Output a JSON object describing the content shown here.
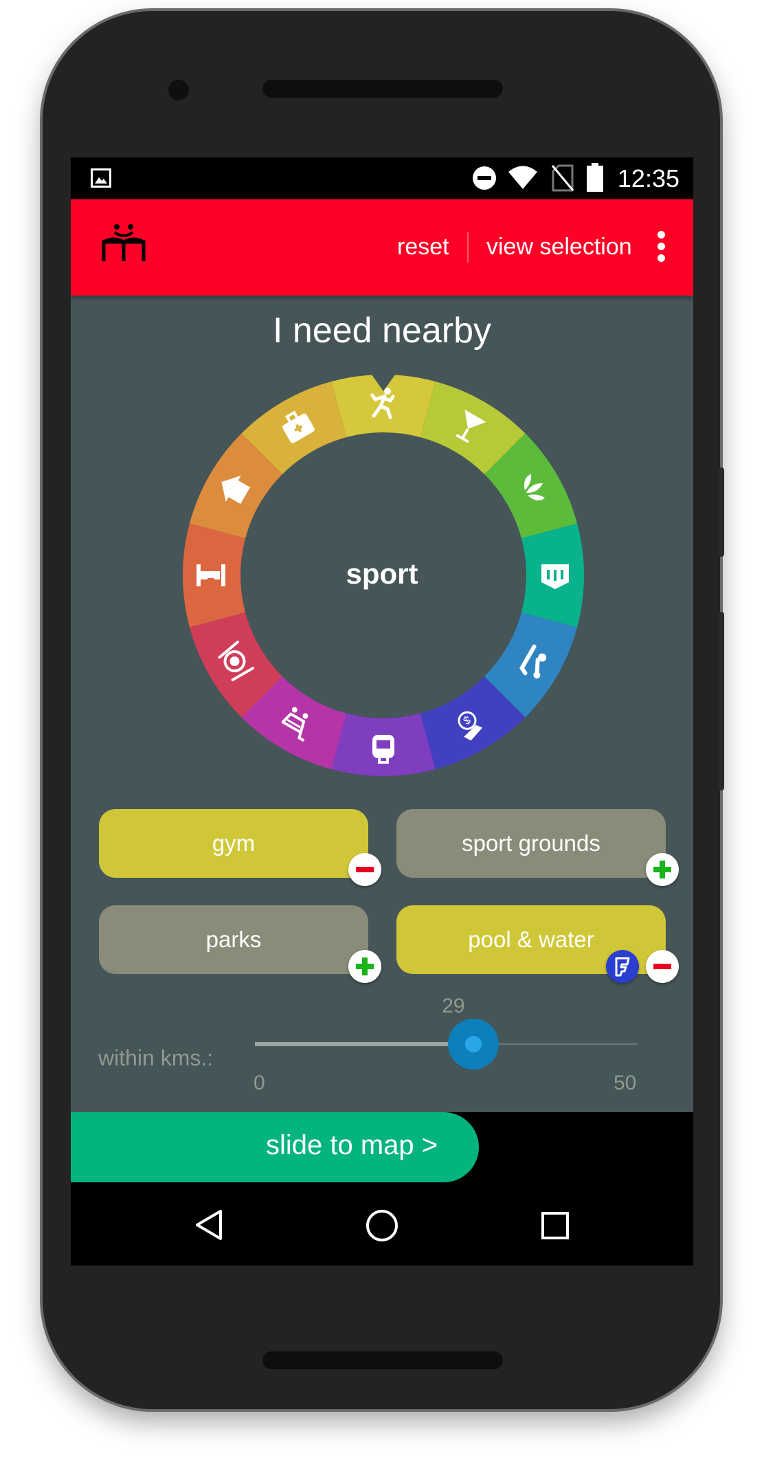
{
  "status_bar": {
    "time": "12:35",
    "icons": [
      "image-icon",
      "do-not-disturb-icon",
      "wifi-icon",
      "no-sim-icon",
      "battery-icon"
    ]
  },
  "app_bar": {
    "logo": "app-logo",
    "actions": {
      "reset": "reset",
      "view_selection": "view selection"
    },
    "overflow": "more-vert-icon",
    "color": "#ff0027"
  },
  "heading": "I need nearby",
  "wheel": {
    "selected": "sport",
    "segments": [
      {
        "icon": "runner-icon",
        "color": "#d5c93b"
      },
      {
        "icon": "cocktail-icon",
        "color": "#b6c937"
      },
      {
        "icon": "lotus-icon",
        "color": "#5dbb3c"
      },
      {
        "icon": "ticket-icon",
        "color": "#08b38b"
      },
      {
        "icon": "massage-icon",
        "color": "#2f85c1"
      },
      {
        "icon": "money-hand-icon",
        "color": "#4140c1"
      },
      {
        "icon": "backpack-icon",
        "color": "#7f3dc0"
      },
      {
        "icon": "shopping-cart-icon",
        "color": "#b535a8"
      },
      {
        "icon": "plate-cutlery-icon",
        "color": "#d03d58"
      },
      {
        "icon": "hydrant-icon",
        "color": "#db6640"
      },
      {
        "icon": "house-icon",
        "color": "#dc8c3d"
      },
      {
        "icon": "first-aid-icon",
        "color": "#d9b23b"
      }
    ]
  },
  "chips": [
    {
      "label": "gym",
      "active": true
    },
    {
      "label": "sport grounds",
      "active": false
    },
    {
      "label": "parks",
      "active": false
    },
    {
      "label": "pool & water",
      "active": true
    }
  ],
  "slider": {
    "label": "within kms.:",
    "value": "29",
    "min": "0",
    "max": "50"
  },
  "slide_button": "slide to map >",
  "nav": [
    "back-icon",
    "home-icon",
    "recents-icon"
  ]
}
